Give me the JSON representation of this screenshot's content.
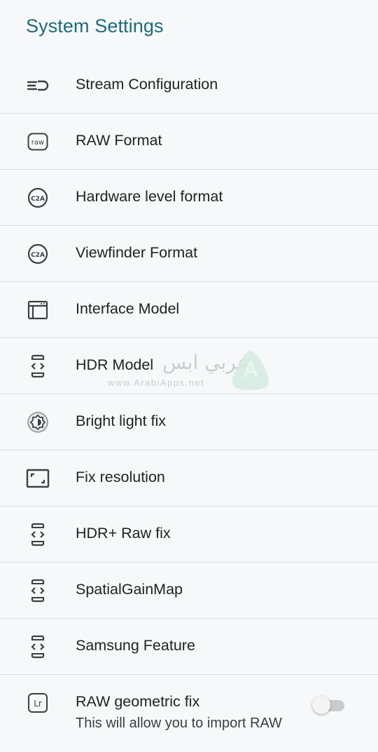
{
  "header": {
    "title": "System Settings"
  },
  "items": [
    {
      "label": "Stream Configuration",
      "icon": "stream-config-icon"
    },
    {
      "label": "RAW Format",
      "icon": "raw-icon"
    },
    {
      "label": "Hardware level format",
      "icon": "c2a-icon"
    },
    {
      "label": "Viewfinder Format",
      "icon": "c2a-icon"
    },
    {
      "label": "Interface Model",
      "icon": "window-icon"
    },
    {
      "label": "HDR Model",
      "icon": "developer-mode-icon"
    },
    {
      "label": "Bright light fix",
      "icon": "brightness-icon"
    },
    {
      "label": "Fix resolution",
      "icon": "aspect-ratio-icon"
    },
    {
      "label": "HDR+ Raw fix",
      "icon": "developer-mode-icon"
    },
    {
      "label": "SpatialGainMap",
      "icon": "developer-mode-icon"
    },
    {
      "label": "Samsung Feature",
      "icon": "developer-mode-icon"
    },
    {
      "label": "RAW geometric fix",
      "icon": "lightroom-icon",
      "subtitle": "This will allow you to import RAW",
      "toggle_on": false
    }
  ],
  "watermark": {
    "text": "عربي ابس",
    "url": "www.ArabiApps.net"
  },
  "colors": {
    "accent": "#1c6b78",
    "divider": "#d9dbde",
    "background": "#f7f8fa"
  }
}
